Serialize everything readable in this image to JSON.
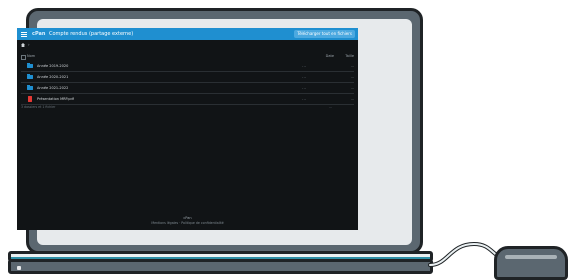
{
  "app": {
    "logo_text": "cPan",
    "title": "Compte rendus (partage externe)",
    "action_button": "Télécharger tout en fichiers"
  },
  "breadcrumb": {
    "home_icon": "home-icon",
    "separator": "›"
  },
  "table": {
    "headers": {
      "name": "Nom",
      "date": "Date",
      "size": "Taille"
    },
    "rows": [
      {
        "type": "folder",
        "icon": "folder-icon",
        "name": "Année 2019-2020",
        "date": "...",
        "size": "..."
      },
      {
        "type": "folder",
        "icon": "folder-icon",
        "name": "Année 2020-2021",
        "date": "...",
        "size": "..."
      },
      {
        "type": "folder",
        "icon": "folder-icon",
        "name": "Année 2021-2022",
        "date": "...",
        "size": "..."
      },
      {
        "type": "pdf",
        "icon": "pdf-icon",
        "name": "Présentation MRP.pdf",
        "date": "...",
        "size": "..."
      }
    ],
    "summary_left": "3 dossiers et 1 fichier",
    "summary_total": "..."
  },
  "footer": {
    "line1": "cPan",
    "line2": "Mentions légales · Politique de confidentialité"
  },
  "colors": {
    "accent": "#1f8fd0",
    "screen_bg": "#111416",
    "device_body": "#5b6770",
    "base_teal": "#2e8fa6",
    "pdf_red": "#e53935"
  }
}
